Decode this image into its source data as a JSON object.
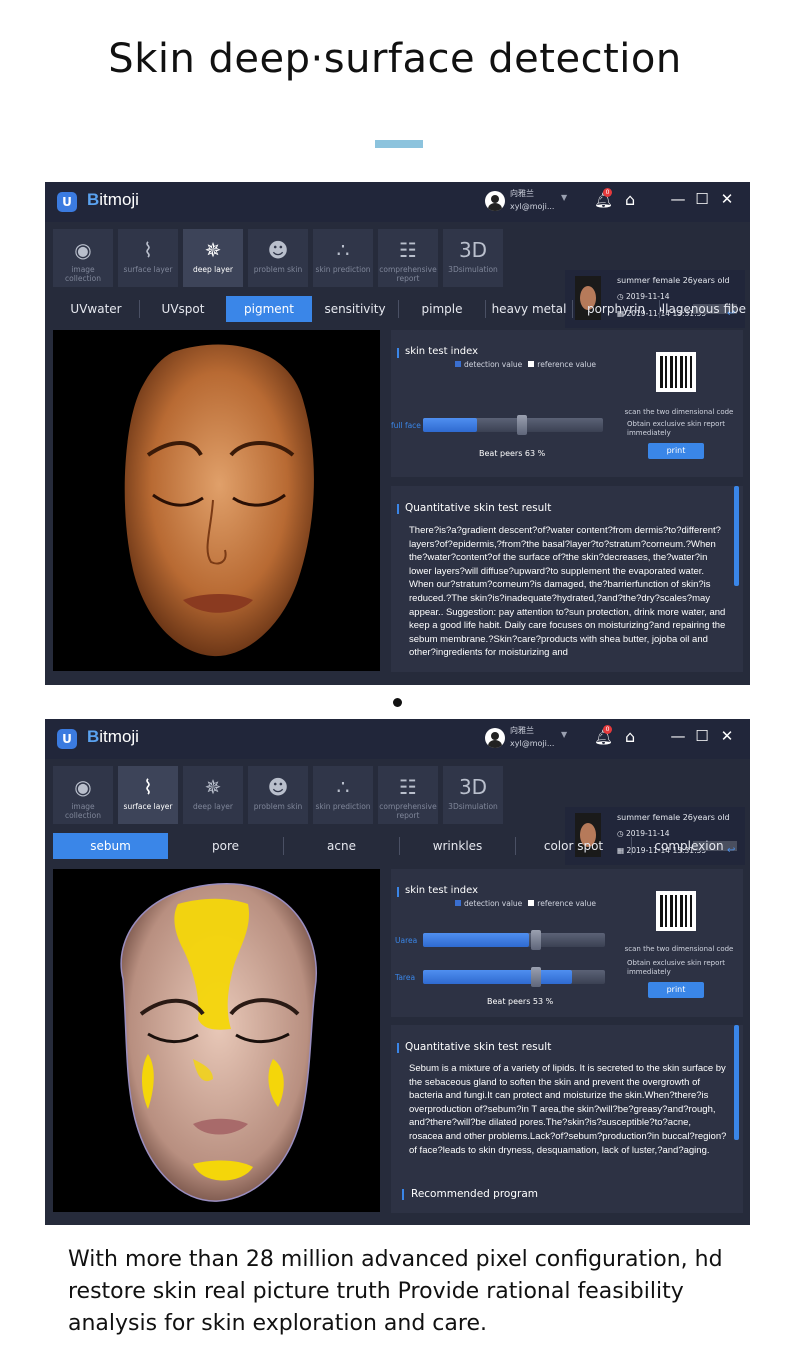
{
  "headline": "Skin deep·surface detection",
  "footer": "With more than 28 million advanced pixel configuration, hd restore skin real picture truth Provide rational feasibility analysis for skin exploration and care.",
  "colors": {
    "accent": "#3a86e8",
    "window_bg": "#262b3b",
    "panel_bg": "#2d3244",
    "sebum_highlight": "#f4d60a"
  },
  "windows": [
    {
      "app_name_prefix": "B",
      "app_name_rest": "itmoji",
      "user_name": "向雅兰",
      "user_email": "xyl@moji...",
      "notification_count": "0",
      "toolbar": [
        {
          "label": "image collection",
          "icon": "camera-icon",
          "glyph": "◉"
        },
        {
          "label": "surface layer",
          "icon": "surface-layer-icon",
          "glyph": "⌇"
        },
        {
          "label": "deep layer",
          "icon": "molecule-icon",
          "glyph": "✵"
        },
        {
          "label": "problem skin",
          "icon": "face-icon",
          "glyph": "☻"
        },
        {
          "label": "skin prediction",
          "icon": "dots-icon",
          "glyph": "∴"
        },
        {
          "label": "comprehensive report",
          "icon": "report-icon",
          "glyph": "☷"
        },
        {
          "label": "3Dsimulation",
          "icon": "3d-icon",
          "glyph": "3D"
        }
      ],
      "active_tool": "deep layer",
      "profile": {
        "info": "summer  female  26years old",
        "date1": "2019-11-14",
        "date2": "2019-11-14 13:31:55"
      },
      "tabs": [
        "UVwater",
        "UVspot",
        "pigment",
        "sensitivity",
        "pimple",
        "heavy metal",
        "porphyrin",
        "collagenous fibe"
      ],
      "active_tab": "pigment",
      "index": {
        "title": "skin test index",
        "legend_detection": "detection value",
        "legend_reference": "reference value",
        "bars": [
          {
            "label": "full face",
            "detection": 0.3,
            "reference": 0.55
          }
        ],
        "beat": "Beat peers 63 %",
        "scan": "scan the two dimensional code",
        "obtain": "Obtain exclusive skin report immediately",
        "print": "print"
      },
      "result": {
        "title": "Quantitative skin test result",
        "text": "There?is?a?gradient descent?of?water content?from dermis?to?different?layers?of?epidermis,?from?the basal?layer?to?stratum?corneum.?When the?water?content?of the surface of?the skin?decreases, the?water?in lower layers?will diffuse?upward?to supplement the evaporated water. When our?stratum?corneum?is damaged, the?barrierfunction of skin?is reduced.?The skin?is?inadequate?hydrated,?and?the?dry?scales?may appear.. Suggestion: pay attention to?sun protection, drink more water, and keep a good life habit. Daily care focuses on moisturizing?and repairing the sebum membrane.?Skin?care?products with shea butter, jojoba oil and other?ingredients for moisturizing and"
      }
    },
    {
      "app_name_prefix": "B",
      "app_name_rest": "itmoji",
      "user_name": "向雅兰",
      "user_email": "xyl@moji...",
      "notification_count": "0",
      "toolbar": [
        {
          "label": "image collection",
          "icon": "camera-icon",
          "glyph": "◉"
        },
        {
          "label": "surface layer",
          "icon": "surface-layer-icon",
          "glyph": "⌇"
        },
        {
          "label": "deep layer",
          "icon": "molecule-icon",
          "glyph": "✵"
        },
        {
          "label": "problem skin",
          "icon": "face-icon",
          "glyph": "☻"
        },
        {
          "label": "skin prediction",
          "icon": "dots-icon",
          "glyph": "∴"
        },
        {
          "label": "comprehensive report",
          "icon": "report-icon",
          "glyph": "☷"
        },
        {
          "label": "3Dsimulation",
          "icon": "3d-icon",
          "glyph": "3D"
        }
      ],
      "active_tool": "surface layer",
      "profile": {
        "info": "summer  female  26years old",
        "date1": "2019-11-14",
        "date2": "2019-11-14 13:31:55"
      },
      "tabs": [
        "sebum",
        "pore",
        "acne",
        "wrinkles",
        "color spot",
        "complexion"
      ],
      "active_tab": "sebum",
      "index": {
        "title": "skin test index",
        "legend_detection": "detection value",
        "legend_reference": "reference value",
        "bars": [
          {
            "label": "Uarea",
            "detection": 0.58,
            "reference": 0.62
          },
          {
            "label": "Tarea",
            "detection": 0.82,
            "reference": 0.62
          }
        ],
        "beat": "Beat peers 53 %",
        "scan": "scan the two dimensional code",
        "obtain": "Obtain exclusive skin report immediately",
        "print": "print"
      },
      "result": {
        "title": "Quantitative skin test result",
        "text": "Sebum is a mixture of a variety of lipids. It is secreted to the skin surface by the sebaceous gland to soften the skin and prevent the overgrowth of bacteria and fungi.It can protect and moisturize the skin.When?there?is overproduction of?sebum?in T area,the skin?will?be?greasy?and?rough, and?there?will?be dilated pores.The?skin?is?susceptible?to?acne, rosacea and other problems.Lack?of?sebum?production?in buccal?region?of face?leads to skin dryness, desquamation, lack of luster,?and?aging.",
        "recommended": "Recommended program"
      }
    }
  ]
}
